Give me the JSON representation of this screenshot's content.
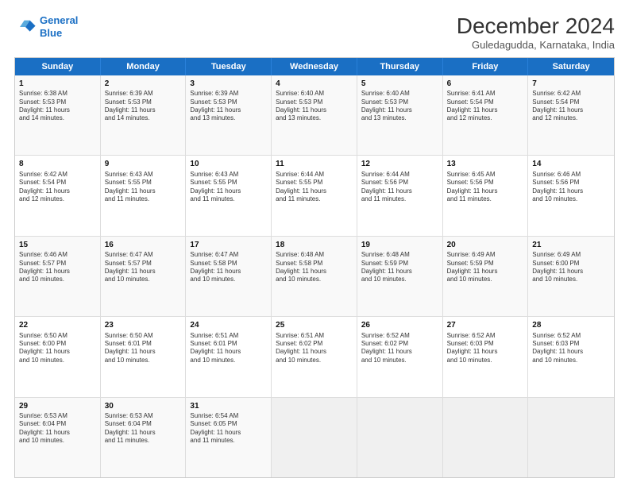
{
  "header": {
    "logo_line1": "General",
    "logo_line2": "Blue",
    "main_title": "December 2024",
    "subtitle": "Guledagudda, Karnataka, India"
  },
  "days_of_week": [
    "Sunday",
    "Monday",
    "Tuesday",
    "Wednesday",
    "Thursday",
    "Friday",
    "Saturday"
  ],
  "weeks": [
    [
      {
        "day": "1",
        "lines": [
          "Sunrise: 6:38 AM",
          "Sunset: 5:53 PM",
          "Daylight: 11 hours",
          "and 14 minutes."
        ]
      },
      {
        "day": "2",
        "lines": [
          "Sunrise: 6:39 AM",
          "Sunset: 5:53 PM",
          "Daylight: 11 hours",
          "and 14 minutes."
        ]
      },
      {
        "day": "3",
        "lines": [
          "Sunrise: 6:39 AM",
          "Sunset: 5:53 PM",
          "Daylight: 11 hours",
          "and 13 minutes."
        ]
      },
      {
        "day": "4",
        "lines": [
          "Sunrise: 6:40 AM",
          "Sunset: 5:53 PM",
          "Daylight: 11 hours",
          "and 13 minutes."
        ]
      },
      {
        "day": "5",
        "lines": [
          "Sunrise: 6:40 AM",
          "Sunset: 5:53 PM",
          "Daylight: 11 hours",
          "and 13 minutes."
        ]
      },
      {
        "day": "6",
        "lines": [
          "Sunrise: 6:41 AM",
          "Sunset: 5:54 PM",
          "Daylight: 11 hours",
          "and 12 minutes."
        ]
      },
      {
        "day": "7",
        "lines": [
          "Sunrise: 6:42 AM",
          "Sunset: 5:54 PM",
          "Daylight: 11 hours",
          "and 12 minutes."
        ]
      }
    ],
    [
      {
        "day": "8",
        "lines": [
          "Sunrise: 6:42 AM",
          "Sunset: 5:54 PM",
          "Daylight: 11 hours",
          "and 12 minutes."
        ]
      },
      {
        "day": "9",
        "lines": [
          "Sunrise: 6:43 AM",
          "Sunset: 5:55 PM",
          "Daylight: 11 hours",
          "and 11 minutes."
        ]
      },
      {
        "day": "10",
        "lines": [
          "Sunrise: 6:43 AM",
          "Sunset: 5:55 PM",
          "Daylight: 11 hours",
          "and 11 minutes."
        ]
      },
      {
        "day": "11",
        "lines": [
          "Sunrise: 6:44 AM",
          "Sunset: 5:55 PM",
          "Daylight: 11 hours",
          "and 11 minutes."
        ]
      },
      {
        "day": "12",
        "lines": [
          "Sunrise: 6:44 AM",
          "Sunset: 5:56 PM",
          "Daylight: 11 hours",
          "and 11 minutes."
        ]
      },
      {
        "day": "13",
        "lines": [
          "Sunrise: 6:45 AM",
          "Sunset: 5:56 PM",
          "Daylight: 11 hours",
          "and 11 minutes."
        ]
      },
      {
        "day": "14",
        "lines": [
          "Sunrise: 6:46 AM",
          "Sunset: 5:56 PM",
          "Daylight: 11 hours",
          "and 10 minutes."
        ]
      }
    ],
    [
      {
        "day": "15",
        "lines": [
          "Sunrise: 6:46 AM",
          "Sunset: 5:57 PM",
          "Daylight: 11 hours",
          "and 10 minutes."
        ]
      },
      {
        "day": "16",
        "lines": [
          "Sunrise: 6:47 AM",
          "Sunset: 5:57 PM",
          "Daylight: 11 hours",
          "and 10 minutes."
        ]
      },
      {
        "day": "17",
        "lines": [
          "Sunrise: 6:47 AM",
          "Sunset: 5:58 PM",
          "Daylight: 11 hours",
          "and 10 minutes."
        ]
      },
      {
        "day": "18",
        "lines": [
          "Sunrise: 6:48 AM",
          "Sunset: 5:58 PM",
          "Daylight: 11 hours",
          "and 10 minutes."
        ]
      },
      {
        "day": "19",
        "lines": [
          "Sunrise: 6:48 AM",
          "Sunset: 5:59 PM",
          "Daylight: 11 hours",
          "and 10 minutes."
        ]
      },
      {
        "day": "20",
        "lines": [
          "Sunrise: 6:49 AM",
          "Sunset: 5:59 PM",
          "Daylight: 11 hours",
          "and 10 minutes."
        ]
      },
      {
        "day": "21",
        "lines": [
          "Sunrise: 6:49 AM",
          "Sunset: 6:00 PM",
          "Daylight: 11 hours",
          "and 10 minutes."
        ]
      }
    ],
    [
      {
        "day": "22",
        "lines": [
          "Sunrise: 6:50 AM",
          "Sunset: 6:00 PM",
          "Daylight: 11 hours",
          "and 10 minutes."
        ]
      },
      {
        "day": "23",
        "lines": [
          "Sunrise: 6:50 AM",
          "Sunset: 6:01 PM",
          "Daylight: 11 hours",
          "and 10 minutes."
        ]
      },
      {
        "day": "24",
        "lines": [
          "Sunrise: 6:51 AM",
          "Sunset: 6:01 PM",
          "Daylight: 11 hours",
          "and 10 minutes."
        ]
      },
      {
        "day": "25",
        "lines": [
          "Sunrise: 6:51 AM",
          "Sunset: 6:02 PM",
          "Daylight: 11 hours",
          "and 10 minutes."
        ]
      },
      {
        "day": "26",
        "lines": [
          "Sunrise: 6:52 AM",
          "Sunset: 6:02 PM",
          "Daylight: 11 hours",
          "and 10 minutes."
        ]
      },
      {
        "day": "27",
        "lines": [
          "Sunrise: 6:52 AM",
          "Sunset: 6:03 PM",
          "Daylight: 11 hours",
          "and 10 minutes."
        ]
      },
      {
        "day": "28",
        "lines": [
          "Sunrise: 6:52 AM",
          "Sunset: 6:03 PM",
          "Daylight: 11 hours",
          "and 10 minutes."
        ]
      }
    ],
    [
      {
        "day": "29",
        "lines": [
          "Sunrise: 6:53 AM",
          "Sunset: 6:04 PM",
          "Daylight: 11 hours",
          "and 10 minutes."
        ]
      },
      {
        "day": "30",
        "lines": [
          "Sunrise: 6:53 AM",
          "Sunset: 6:04 PM",
          "Daylight: 11 hours",
          "and 11 minutes."
        ]
      },
      {
        "day": "31",
        "lines": [
          "Sunrise: 6:54 AM",
          "Sunset: 6:05 PM",
          "Daylight: 11 hours",
          "and 11 minutes."
        ]
      },
      {
        "day": "",
        "lines": []
      },
      {
        "day": "",
        "lines": []
      },
      {
        "day": "",
        "lines": []
      },
      {
        "day": "",
        "lines": []
      }
    ]
  ]
}
